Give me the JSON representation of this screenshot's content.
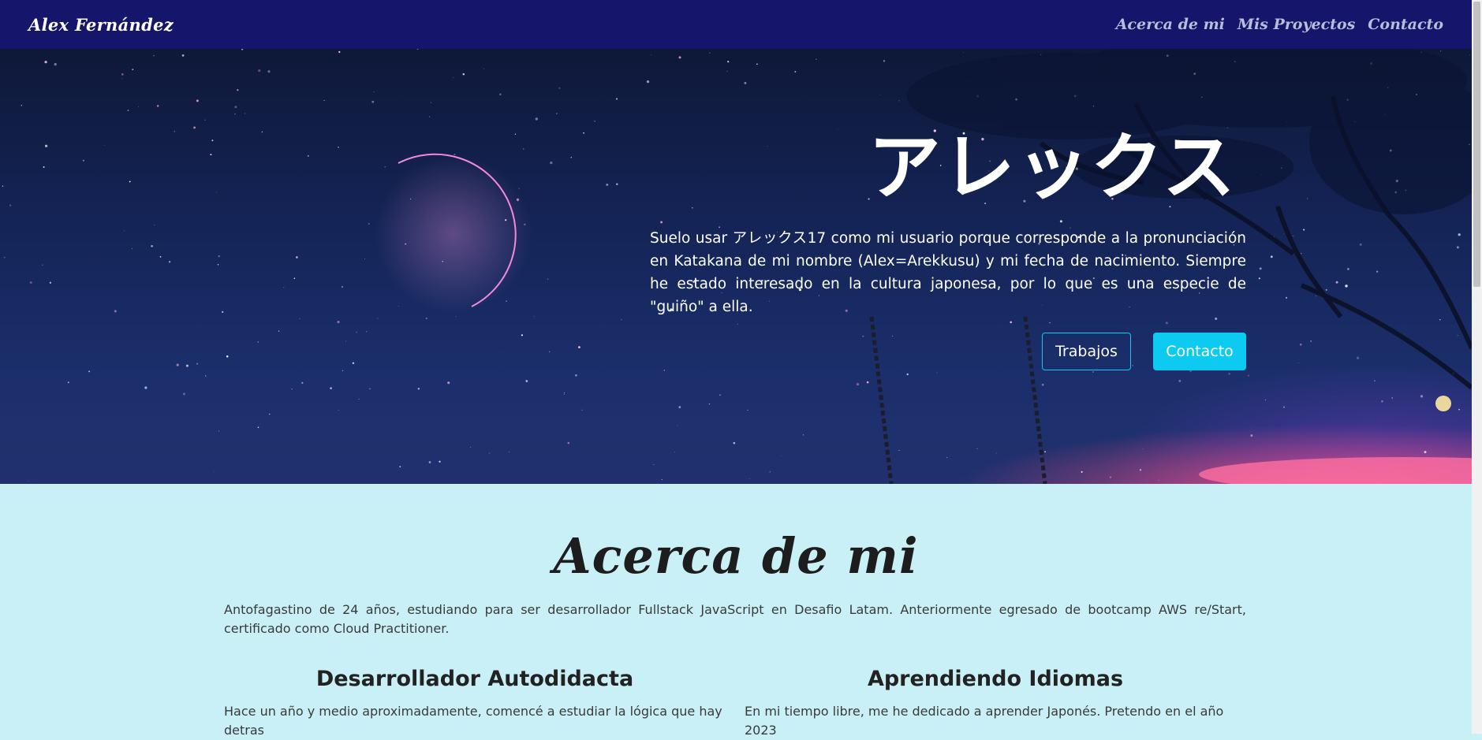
{
  "navbar": {
    "brand": "Alex Fernández",
    "links": [
      "Acerca de mi",
      "Mis Proyectos",
      "Contacto"
    ]
  },
  "hero": {
    "title": "アレックス",
    "description": "Suelo usar アレックス17 como mi usuario porque corresponde a la pronunciación en Katakana de mi nombre (Alex=Arekkusu) y mi fecha de nacimiento. Siempre he estado interesado en la cultura japonesa, por lo que es una especie de \"guiño\" a ella.",
    "buttons": {
      "works": "Trabajos",
      "contact": "Contacto"
    }
  },
  "about": {
    "title": "Acerca de mi",
    "intro": "Antofagastino de 24 años, estudiando para ser desarrollador Fullstack JavaScript en Desafio Latam. Anteriormente egresado de bootcamp AWS re/Start, certificado como Cloud Practitioner.",
    "columns": [
      {
        "heading": "Desarrollador Autodidacta",
        "text": "Hace un año y medio aproximadamente, comencé a estudiar la lógica que hay detras"
      },
      {
        "heading": "Aprendiendo Idiomas",
        "text": "En mi tiempo libre, me he dedicado a aprender Japonés. Pretendo en el año 2023"
      }
    ]
  },
  "colors": {
    "navbar": "#15156c",
    "accent": "#0dcaf0",
    "about_bg": "#c8f0f6"
  }
}
